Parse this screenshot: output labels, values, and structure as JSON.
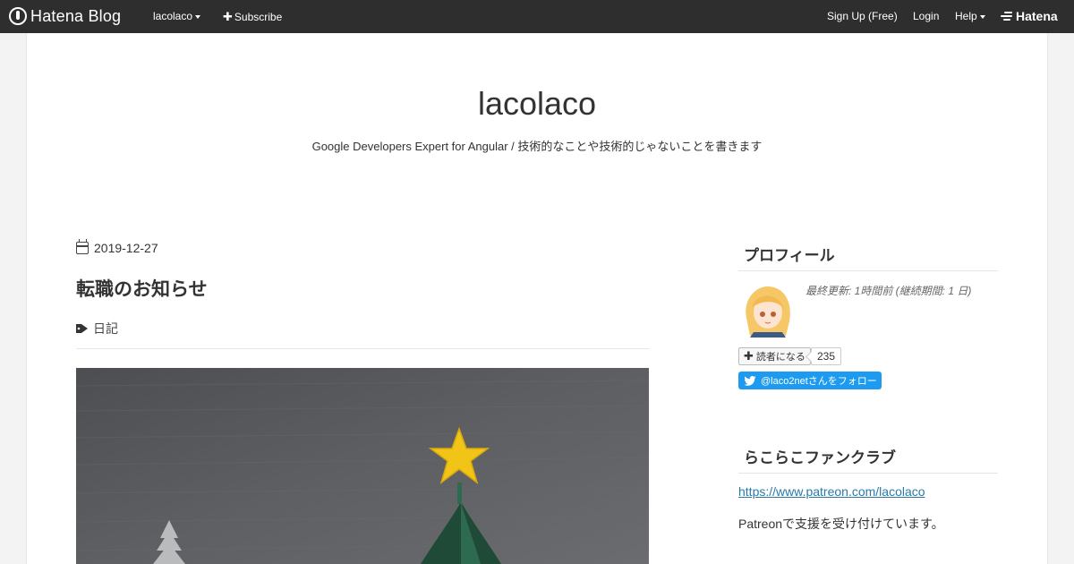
{
  "topbar": {
    "logo_text": "Hatena Blog",
    "user_menu": "lacolaco",
    "subscribe": "Subscribe",
    "signup": "Sign Up (Free)",
    "login": "Login",
    "help": "Help",
    "brand": "Hatena"
  },
  "blog": {
    "title": "lacolaco",
    "description": "Google Developers Expert for Angular / 技術的なことや技術的じゃないことを書きます"
  },
  "entry": {
    "date": "2019-12-27",
    "title": "転職のお知らせ",
    "category": "日記"
  },
  "sidebar": {
    "profile_heading": "プロフィール",
    "last_updated": "最終更新: 1時間前 (継続期間: 1 日)",
    "reader_button": "読者になる",
    "reader_count": "235",
    "twitter_follow": "@laco2netさんをフォロー",
    "fanclub_heading": "らこらこファンクラブ",
    "fanclub_link": "https://www.patreon.com/lacolaco",
    "fanclub_text": "Patreonで支援を受け付けています。"
  },
  "colors": {
    "topbar": "#2e2e2e",
    "link": "#2a7aa8",
    "twitter": "#1d9bf0"
  }
}
